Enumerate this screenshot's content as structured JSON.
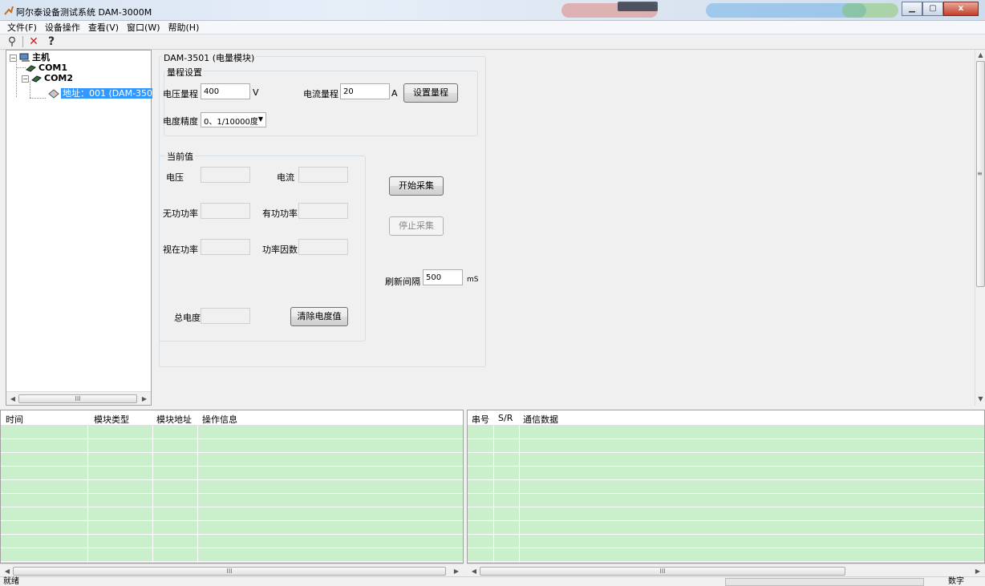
{
  "window": {
    "title": "阿尔泰设备测试系统 DAM-3000M",
    "minimize_icon": "minimize-icon",
    "maximize_icon": "maximize-icon",
    "close_icon": "close-icon",
    "close_label": "x"
  },
  "menu": {
    "items": [
      "文件(F)",
      "设备操作",
      "查看(V)",
      "窗口(W)",
      "帮助(H)"
    ]
  },
  "toolbar": {
    "icons": [
      "search-icon",
      "delete-x-icon",
      "help-question-icon"
    ],
    "search_glyph": "⚲",
    "delete_glyph": "✕",
    "help_glyph": "?"
  },
  "tree": {
    "root_label": "主机",
    "com1_label": "COM1",
    "com2_label": "COM2",
    "device_label": "地址：001 (DAM-3501)",
    "expand_minus": "−",
    "scroll_grip": "III"
  },
  "form": {
    "outer_group_label": "DAM-3501 (电量模块)",
    "range_group": {
      "label": "量程设置",
      "voltage_label": "电压量程",
      "voltage_value": "400",
      "voltage_unit": "V",
      "current_label": "电流量程",
      "current_value": "20",
      "current_unit": "A",
      "set_button": "设置量程",
      "precision_label": "电度精度",
      "precision_value": "0、1/10000度"
    },
    "current_group": {
      "label": "当前值",
      "voltage": "电压",
      "current": "电流",
      "reactive_power": "无功功率",
      "active_power": "有功功率",
      "apparent_power": "视在功率",
      "power_factor": "功率因数",
      "total_energy": "总电度",
      "clear_button": "清除电度值"
    },
    "start_button": "开始采集",
    "stop_button": "停止采集",
    "refresh_label": "刷新间隔",
    "refresh_value": "500",
    "refresh_unit": "mS"
  },
  "log_left": {
    "columns": [
      "时间",
      "模块类型",
      "模块地址",
      "操作信息"
    ],
    "scroll_grip": "III"
  },
  "log_right": {
    "columns": [
      "串号",
      "S/R",
      "通信数据"
    ],
    "scroll_grip": "III"
  },
  "status": {
    "text": "就绪",
    "mode": "数字"
  },
  "colors": {
    "grid_row": "#c9efcb",
    "selection": "#3399ff"
  }
}
